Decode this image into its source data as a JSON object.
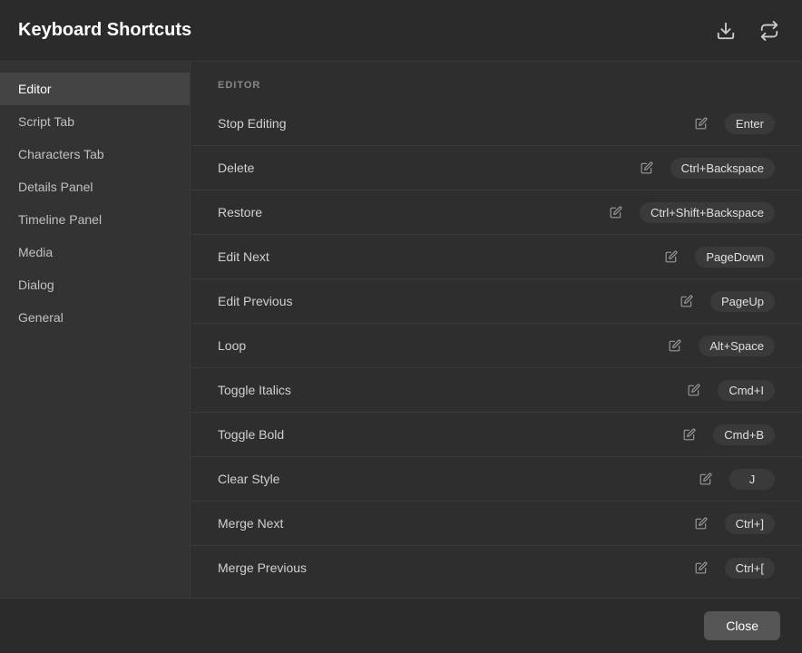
{
  "header": {
    "title": "Keyboard Shortcuts",
    "download_icon": "⬇",
    "export_icon": "↑"
  },
  "sidebar": {
    "items": [
      {
        "id": "editor",
        "label": "Editor",
        "active": true
      },
      {
        "id": "script-tab",
        "label": "Script Tab",
        "active": false
      },
      {
        "id": "characters-tab",
        "label": "Characters Tab",
        "active": false
      },
      {
        "id": "details-panel",
        "label": "Details Panel",
        "active": false
      },
      {
        "id": "timeline-panel",
        "label": "Timeline Panel",
        "active": false
      },
      {
        "id": "media",
        "label": "Media",
        "active": false
      },
      {
        "id": "dialog",
        "label": "Dialog",
        "active": false
      },
      {
        "id": "general",
        "label": "General",
        "active": false
      }
    ]
  },
  "content": {
    "section_label": "EDITOR",
    "shortcuts": [
      {
        "name": "Stop Editing",
        "key": "Enter"
      },
      {
        "name": "Delete",
        "key": "Ctrl+Backspace"
      },
      {
        "name": "Restore",
        "key": "Ctrl+Shift+Backspace"
      },
      {
        "name": "Edit Next",
        "key": "PageDown"
      },
      {
        "name": "Edit Previous",
        "key": "PageUp"
      },
      {
        "name": "Loop",
        "key": "Alt+Space"
      },
      {
        "name": "Toggle Italics",
        "key": "Cmd+I"
      },
      {
        "name": "Toggle Bold",
        "key": "Cmd+B"
      },
      {
        "name": "Clear Style",
        "key": "J"
      },
      {
        "name": "Merge Next",
        "key": "Ctrl+]"
      },
      {
        "name": "Merge Previous",
        "key": "Ctrl+["
      }
    ]
  },
  "footer": {
    "close_label": "Close"
  }
}
